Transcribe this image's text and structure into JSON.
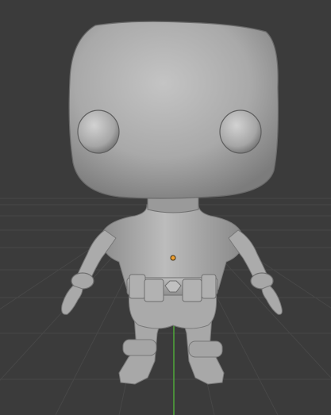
{
  "viewport": {
    "background": "#3b3b3b",
    "grid_color": "#444444",
    "z_axis_color": "#4fa83a",
    "origin_color": "#f0a030",
    "model_color": "#a9a9a9",
    "model_shadow_color": "#6e6e6e",
    "model_highlight_color": "#c6c6c6"
  }
}
